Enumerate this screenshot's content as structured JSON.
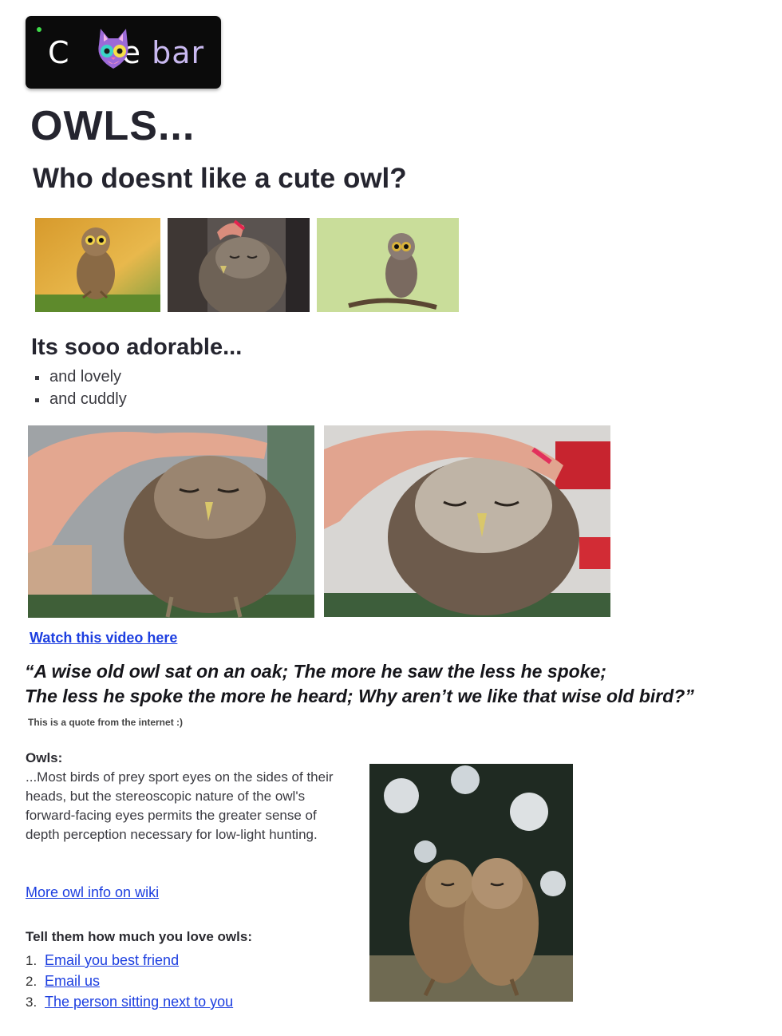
{
  "logo": {
    "text_c": "C",
    "text_de": "de",
    "text_bar": "bar",
    "icon": "cat-face-icon",
    "colors": {
      "background": "#0b0b0b",
      "led": "#3fdc4a",
      "bar_text": "#c9b9f0",
      "cat": "#9c6ad8"
    }
  },
  "heading": {
    "title": "OWLS...",
    "subtitle": "Who doesnt like a cute owl?"
  },
  "gallery_small": [
    {
      "name": "owl-photo-autumn"
    },
    {
      "name": "owl-photo-petted"
    },
    {
      "name": "owl-photo-branch"
    }
  ],
  "adorable": {
    "title": "Its sooo adorable...",
    "items": [
      "and lovely",
      "and cuddly"
    ]
  },
  "gallery_large": [
    {
      "name": "owl-video-frame-1"
    },
    {
      "name": "owl-video-frame-2"
    }
  ],
  "video_link": "Watch this video here",
  "quote": {
    "line1": "“A wise old owl sat on an oak;  The more he saw the less he spoke;",
    "line2": "The less he spoke the more he heard; Why aren’t we like that wise old bird?”",
    "note": "This is a quote from the internet :)"
  },
  "info": {
    "heading": "Owls:",
    "body": "...Most birds of prey sport eyes on the sides of their heads, but the stereoscopic nature of the owl's forward-facing eyes permits the greater sense of depth perception necessary for low-light hunting.",
    "wiki_link": "More owl info on wiki"
  },
  "love": {
    "heading": "Tell them how much you love owls:",
    "items": [
      {
        "num": "1.",
        "label": "Email you best friend"
      },
      {
        "num": "2.",
        "label": "Email us"
      },
      {
        "num": "3.",
        "label": "The person sitting next to you"
      }
    ]
  },
  "colors": {
    "text": "#2b2b35",
    "link": "#1c3ee0"
  }
}
